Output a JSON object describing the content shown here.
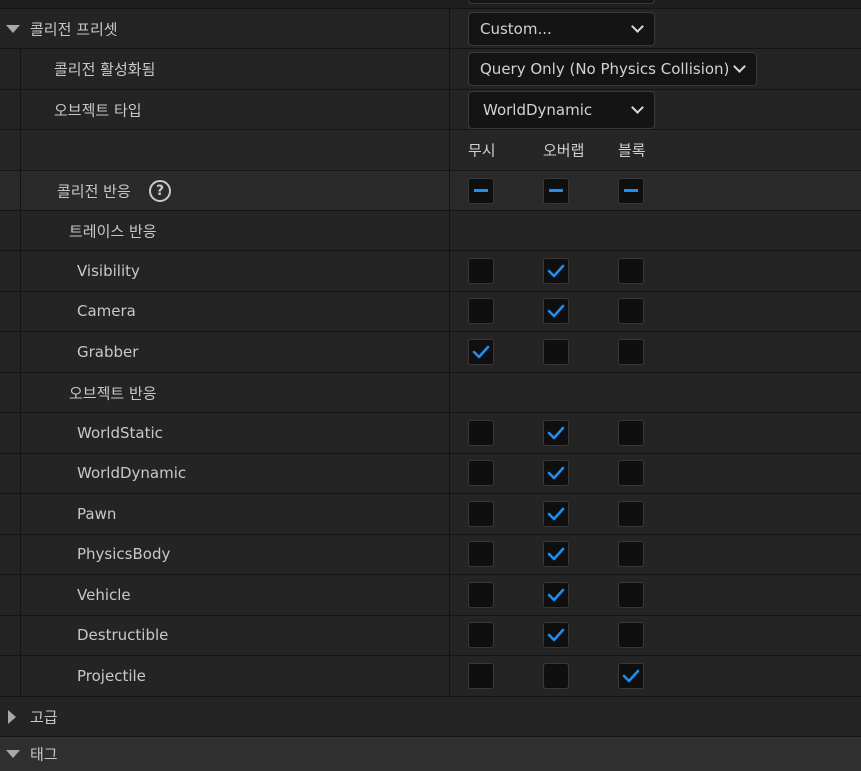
{
  "preset": {
    "label": "콜리전 프리셋",
    "value": "Custom..."
  },
  "enabled": {
    "label": "콜리전 활성화됨",
    "value": "Query Only (No Physics Collision)"
  },
  "object_type": {
    "label": "오브젝트 타입",
    "value": "WorldDynamic"
  },
  "columns": {
    "ignore": "무시",
    "overlap": "오버랩",
    "block": "블록"
  },
  "responses": {
    "label": "콜리전 반응",
    "help": "?"
  },
  "trace": {
    "label": "트레이스 반응",
    "items": [
      {
        "name": "Visibility",
        "state": "overlap"
      },
      {
        "name": "Camera",
        "state": "overlap"
      },
      {
        "name": "Grabber",
        "state": "ignore"
      }
    ]
  },
  "object": {
    "label": "오브젝트 반응",
    "items": [
      {
        "name": "WorldStatic",
        "state": "overlap"
      },
      {
        "name": "WorldDynamic",
        "state": "overlap"
      },
      {
        "name": "Pawn",
        "state": "overlap"
      },
      {
        "name": "PhysicsBody",
        "state": "overlap"
      },
      {
        "name": "Vehicle",
        "state": "overlap"
      },
      {
        "name": "Destructible",
        "state": "overlap"
      },
      {
        "name": "Projectile",
        "state": "block"
      }
    ]
  },
  "advanced": {
    "label": "고급"
  },
  "tags": {
    "label": "태그"
  },
  "colors": {
    "accent": "#1f8ef1",
    "checkbox_bg": "#0f0f0f"
  }
}
